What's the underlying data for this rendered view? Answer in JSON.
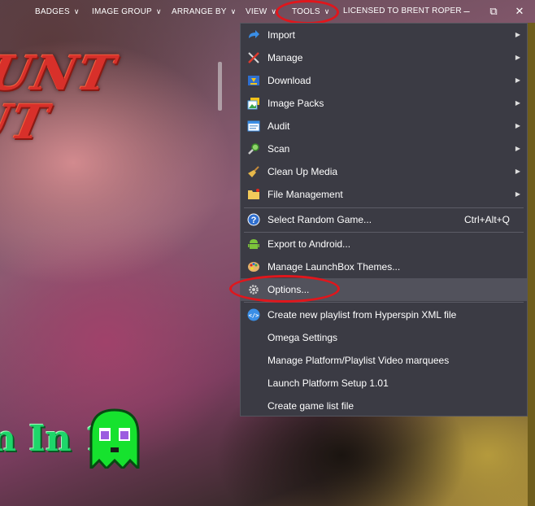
{
  "topbar": {
    "items": [
      {
        "label": "BADGES"
      },
      {
        "label": "IMAGE GROUP"
      },
      {
        "label": "ARRANGE BY"
      },
      {
        "label": "VIEW"
      },
      {
        "label": "TOOLS"
      }
    ],
    "license": "LICENSED TO BRENT ROPER"
  },
  "background": {
    "title_line1": "UNT",
    "title_line2": "UT",
    "game_text": "n In 1"
  },
  "menu": {
    "items": [
      {
        "label": "Import",
        "icon": "import-arrow-icon",
        "submenu": true
      },
      {
        "label": "Manage",
        "icon": "wrench-screwdriver-icon",
        "submenu": true
      },
      {
        "label": "Download",
        "icon": "download-icon",
        "submenu": true
      },
      {
        "label": "Image Packs",
        "icon": "image-packs-icon",
        "submenu": true
      },
      {
        "label": "Audit",
        "icon": "audit-icon",
        "submenu": true
      },
      {
        "label": "Scan",
        "icon": "scan-magnifier-icon",
        "submenu": true
      },
      {
        "label": "Clean Up Media",
        "icon": "broom-icon",
        "submenu": true
      },
      {
        "label": "File Management",
        "icon": "folder-icon",
        "submenu": true
      },
      {
        "label": "Select Random Game...",
        "icon": "question-icon",
        "shortcut": "Ctrl+Alt+Q"
      },
      {
        "label": "Export to Android...",
        "icon": "android-icon"
      },
      {
        "label": "Manage LaunchBox Themes...",
        "icon": "palette-icon"
      },
      {
        "label": "Options...",
        "icon": "gear-icon"
      },
      {
        "label": "Create new playlist from Hyperspin XML file",
        "icon": "code-globe-icon"
      },
      {
        "label": "Omega Settings"
      },
      {
        "label": "Manage Platform/Playlist Video marquees"
      },
      {
        "label": "Launch Platform Setup 1.01"
      },
      {
        "label": "Create game list file"
      }
    ]
  },
  "colors": {
    "menu_bg": "#3b3b44",
    "menu_highlight": "#52525c",
    "annotation_red": "#e0161c"
  }
}
